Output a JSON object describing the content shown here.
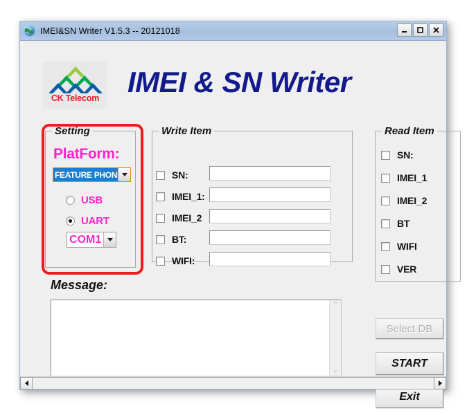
{
  "window": {
    "title": "IMEI&SN Writer V1.5.3 -- 20121018",
    "icon": "globe-icon",
    "minimize_label": "_",
    "maximize_label": "□",
    "close_label": "✕"
  },
  "header": {
    "logo_text": "CK Telecom",
    "app_title": "IMEI & SN Writer",
    "logo_colors": {
      "top_chevron": "#9ACA3C",
      "mid_chevron": "#00A651",
      "bottom_chevron": "#0B5BA8",
      "text": "#D9202A"
    },
    "title_color": "#131A8C"
  },
  "setting": {
    "group_title": "Setting",
    "platform_label": "PlatForm:",
    "platform_value": "FEATURE PHONE",
    "platform_options": [
      "FEATURE PHONE"
    ],
    "connection": [
      {
        "label": "USB",
        "selected": false
      },
      {
        "label": "UART",
        "selected": true
      }
    ],
    "port_value": "COM1",
    "port_options": [
      "COM1"
    ],
    "accent_color": "#FF22CC",
    "annotation_color": "#EE1C1C"
  },
  "write_item": {
    "group_title": "Write Item",
    "rows": [
      {
        "label": "SN:",
        "checked": false,
        "value": ""
      },
      {
        "label": "IMEI_1:",
        "checked": false,
        "value": ""
      },
      {
        "label": "IMEI_2",
        "checked": false,
        "value": ""
      },
      {
        "label": "BT:",
        "checked": false,
        "value": ""
      },
      {
        "label": "WIFI:",
        "checked": false,
        "value": ""
      }
    ]
  },
  "read_item": {
    "group_title": "Read Item",
    "rows": [
      {
        "label": "SN:",
        "checked": false
      },
      {
        "label": "IMEI_1",
        "checked": false
      },
      {
        "label": "IMEI_2",
        "checked": false
      },
      {
        "label": "BT",
        "checked": false
      },
      {
        "label": "WIFI",
        "checked": false
      },
      {
        "label": "VER",
        "checked": false
      }
    ]
  },
  "message": {
    "label": "Message:",
    "text": "",
    "scroll_up": "⌃",
    "scroll_down": "⌄",
    "scroll_left": "‹",
    "scroll_right": "›"
  },
  "buttons": {
    "select_db": "Select DB",
    "select_db_enabled": false,
    "start": "START",
    "exit": "Exit"
  }
}
